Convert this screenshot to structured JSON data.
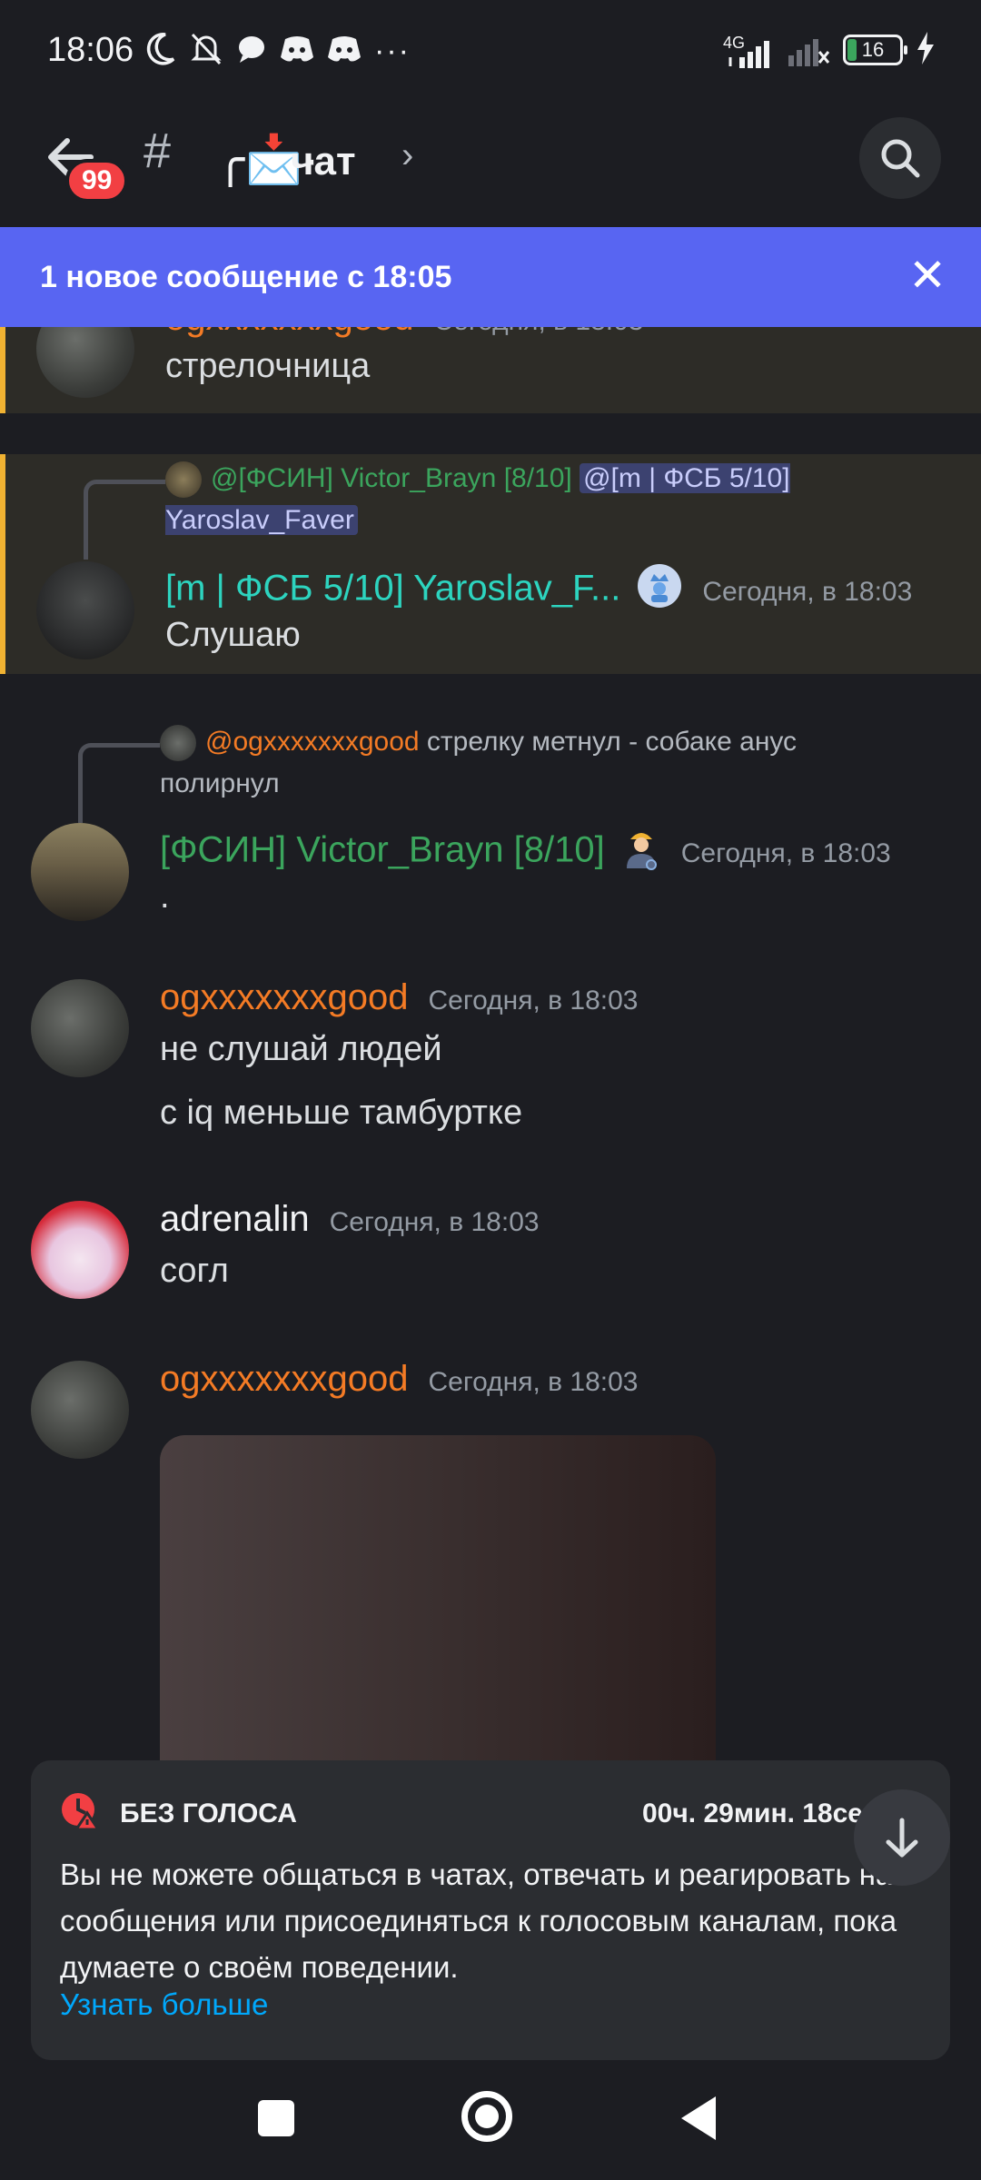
{
  "status_bar": {
    "time": "18:06",
    "network_label": "4G",
    "battery": "16"
  },
  "header": {
    "unread_count": "99",
    "channel_prefix": "#",
    "channel_emoji": "╭📩·",
    "channel_name": "чат",
    "chevron": "›"
  },
  "new_banner": {
    "text": "1 новое сообщение с 18:05",
    "close": "✕"
  },
  "messages": [
    {
      "author": "ogxxxxxxxgood",
      "timestamp": "Сегодня, в 18:03",
      "text": "стрелочница"
    },
    {
      "reply_author": "@[ФСИН] Victor_Brayn [8/10]",
      "reply_mention": "@[m | ФСБ 5/10] Yaroslav_Faver",
      "author": "[m | ФСБ 5/10] Yaroslav_F...",
      "timestamp": "Сегодня, в 18:03",
      "text": "Слушаю"
    },
    {
      "reply_author": "@ogxxxxxxxgood",
      "reply_text": "стрелку метнул - собаке анус полирнул",
      "author": "[ФСИН] Victor_Brayn [8/10]",
      "timestamp": "Сегодня, в 18:03",
      "text": "."
    },
    {
      "author": "ogxxxxxxxgood",
      "timestamp": "Сегодня, в 18:03",
      "text": "не слушай людей",
      "text2": "с iq меньше тамбуртке"
    },
    {
      "author": "adrenalin",
      "timestamp": "Сегодня, в 18:03",
      "text": "согл"
    },
    {
      "author": "ogxxxxxxxgood",
      "timestamp": "Сегодня, в 18:03"
    }
  ],
  "timeout": {
    "title": "БЕЗ ГОЛОСА",
    "timer": "00ч. 29мин. 18се",
    "text": "Вы не можете общаться в чатах, отвечать и реагировать на сообщения или присоединяться к голосовым каналам, пока думаете о своём поведении.",
    "link": "Узнать больше"
  },
  "colors": {
    "background": "#1c1d22",
    "accent": "#5865f2",
    "highlight_bar": "#f0b232",
    "name_orange": "#f47b25",
    "name_green": "#3ba55d",
    "name_teal": "#2dd4bf",
    "link": "#00a8fc"
  }
}
